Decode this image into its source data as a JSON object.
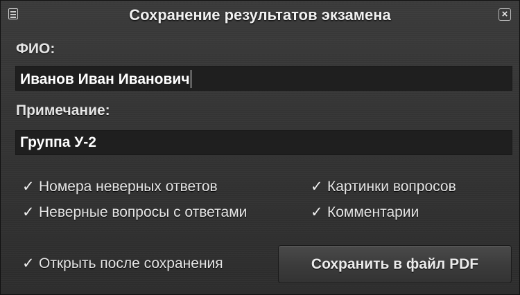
{
  "window": {
    "title": "Сохранение результатов экзамена",
    "close_glyph": "×",
    "menu_icon": "window-menu-icon",
    "close_icon": "close-icon"
  },
  "form": {
    "name_label": "ФИО:",
    "name_value": "Иванов Иван Иванович",
    "note_label": "Примечание:",
    "note_value": "Группа У-2"
  },
  "options": {
    "check_glyph": "✓",
    "wrong_answer_numbers": {
      "label": "Номера неверных ответов",
      "checked": true
    },
    "wrong_questions_with_answers": {
      "label": "Неверные вопросы с ответами",
      "checked": true
    },
    "question_pictures": {
      "label": "Картинки вопросов",
      "checked": true
    },
    "comments": {
      "label": "Комментарии",
      "checked": true
    },
    "open_after_save": {
      "label": "Открыть после сохранения",
      "checked": true
    }
  },
  "actions": {
    "save_label": "Сохранить в файл PDF"
  },
  "colors": {
    "background": "#333333",
    "field_background": "#1f1f1f",
    "text": "#e6e6e6",
    "field_text": "#ffffff"
  }
}
